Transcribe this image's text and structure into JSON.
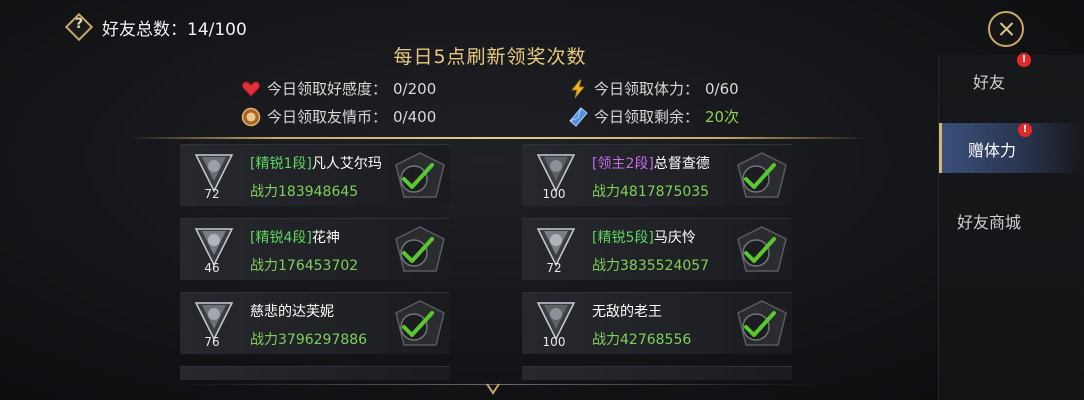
{
  "header": {
    "help_glyph": "?",
    "friend_total_label": "好友总数：",
    "friend_total_value": "14/100"
  },
  "daily": {
    "title": "每日5点刷新领奖次数",
    "stats": [
      {
        "icon": "heart-icon",
        "label": "今日领取好感度：",
        "value": "0/200"
      },
      {
        "icon": "lightning-icon",
        "label": "今日领取体力：",
        "value": "0/60"
      },
      {
        "icon": "coin-icon",
        "label": "今日领取友情币：",
        "value": "0/400"
      },
      {
        "icon": "crystal-icon",
        "label": "今日领取剩余：",
        "value": "20次"
      }
    ]
  },
  "friends": [
    {
      "rank": "[精锐1段]",
      "rank_type": "elite",
      "name": "凡人艾尔玛",
      "power": "战力183948645",
      "level": "72"
    },
    {
      "rank": "[领主2段]",
      "rank_type": "lord",
      "name": "总督查德",
      "power": "战力4817875035",
      "level": "100"
    },
    {
      "rank": "[精锐4段]",
      "rank_type": "elite",
      "name": "花神",
      "power": "战力176453702",
      "level": "46"
    },
    {
      "rank": "[精锐5段]",
      "rank_type": "elite",
      "name": "马庆怜",
      "power": "战力3835524057",
      "level": "72"
    },
    {
      "rank": "",
      "rank_type": "",
      "name": "慈悲的达芙妮",
      "power": "战力3796297886",
      "level": "76"
    },
    {
      "rank": "",
      "rank_type": "",
      "name": "无敌的老王",
      "power": "战力42768556",
      "level": "100"
    }
  ],
  "sidebar": {
    "tabs": [
      {
        "label": "好友",
        "badge": "!"
      },
      {
        "label": "赠体力",
        "badge": "!"
      },
      {
        "label": "好友商城",
        "badge": ""
      }
    ]
  },
  "colors": {
    "gold": "#c9a868",
    "green_value": "#7fd05a",
    "elite_rank": "#5fd45f",
    "lord_rank": "#c46be8",
    "badge_red": "#e02a2a"
  }
}
